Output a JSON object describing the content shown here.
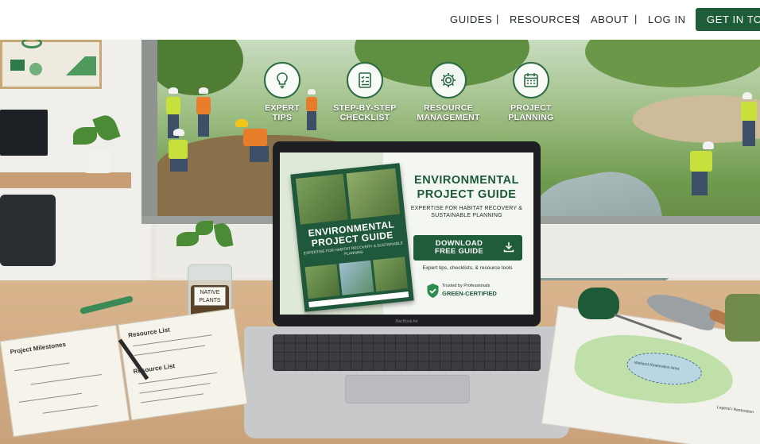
{
  "nav": {
    "links": [
      "GUIDES",
      "RESOURCES",
      "ABOUT",
      "LOG IN"
    ],
    "separator": "|",
    "cta_label": "GET IN TOUCH"
  },
  "features": [
    {
      "icon": "lightbulb-icon",
      "label": "EXPERT\nTIPS"
    },
    {
      "icon": "checklist-icon",
      "label": "STEP-BY-STEP\nCHECKLIST"
    },
    {
      "icon": "gear-icon",
      "label": "RESOURCE\nMANAGEMENT"
    },
    {
      "icon": "calendar-icon",
      "label": "PROJECT\nPLANNING"
    }
  ],
  "ebook": {
    "title": "ENVIRONMENTAL PROJECT GUIDE",
    "subtitle": "EXPERTISE FOR HABITAT RECOVERY & SUSTAINABLE PLANNING"
  },
  "screen": {
    "title": "ENVIRONMENTAL PROJECT GUIDE",
    "subtitle": "EXPERTISE FOR HABITAT RECOVERY & SUSTAINABLE PLANNING",
    "button_label": "DOWNLOAD\nFREE GUIDE",
    "tagline": "Expert tips, checklists, & resource tools",
    "badge_top": "Trusted by Professionals",
    "badge_main": "GREEN-CERTIFIED"
  },
  "laptop_brand": "MacBook Air",
  "jar_label": "NATIVE PLANTS",
  "notebook": {
    "left_heading": "Project Milestones",
    "right_heading": "Resource List",
    "right_heading_2": "Resource List"
  },
  "map": {
    "lake_label": "Wetland Restoration Area",
    "legend_label": "Legend / Restoration"
  },
  "colors": {
    "brand_green": "#1f5c39",
    "accent_green": "#2b6a43",
    "vest_yellow": "#c7e03b"
  }
}
